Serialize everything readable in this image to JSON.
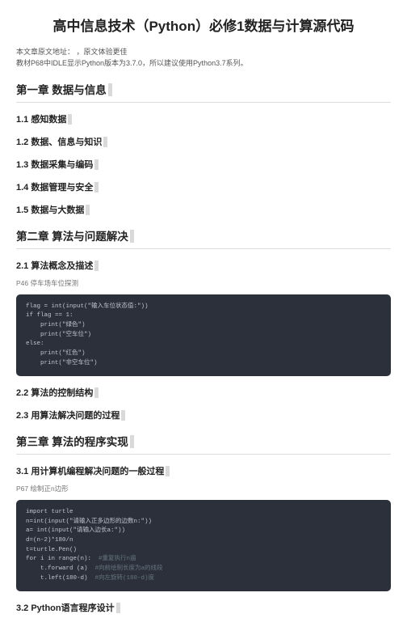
{
  "title": "高中信息技术（Python）必修1数据与计算源代码",
  "intro_line1_prefix": "本文章原文地址：",
  "intro_line1_link": "，原文体验更佳",
  "intro_line2": "教材P68中IDLE显示Python版本为3.7.0，所以建议使用Python3.7系列。",
  "ch1": {
    "title": "第一章 数据与信息",
    "s1": "1.1 感知数据",
    "s2": "1.2 数据、信息与知识",
    "s3": "1.3 数据采集与编码",
    "s4": "1.4 数据管理与安全",
    "s5": "1.5 数据与大数据"
  },
  "ch2": {
    "title": "第二章 算法与问题解决",
    "s1": "2.1 算法概念及描述",
    "s1_caption": "P46 停车场车位探测",
    "s1_code": "flag = int(input(\"输入车位状态值:\"))\nif flag == 1:\n    print(\"绿色\")\n    print(\"空车位\")\nelse:\n    print(\"红色\")\n    print(\"非空车位\")",
    "s2": "2.2 算法的控制结构",
    "s3": "2.3 用算法解决问题的过程"
  },
  "ch3": {
    "title": "第三章 算法的程序实现",
    "s1": "3.1 用计算机编程解决问题的一般过程",
    "s1_caption": "P67 绘制正n边形",
    "s1_code_plain": "import turtle\nn=int(input(\"请输入正多边形的边数n:\"))\na= int(input(\"请输入边长a:\"))\nd=(n-2)*180/n\nt=turtle.Pen()\nfor i in range(n):",
    "s1_code_c1": "  #重复执行n遍",
    "s1_code_l2": "    t.forward (a)",
    "s1_code_c2": "  #向前绘制长度为a的线段",
    "s1_code_l3": "    t.left(180-d)",
    "s1_code_c3": "  #向左旋转(180-d)度",
    "s2": "3.2 Python语言程序设计"
  }
}
